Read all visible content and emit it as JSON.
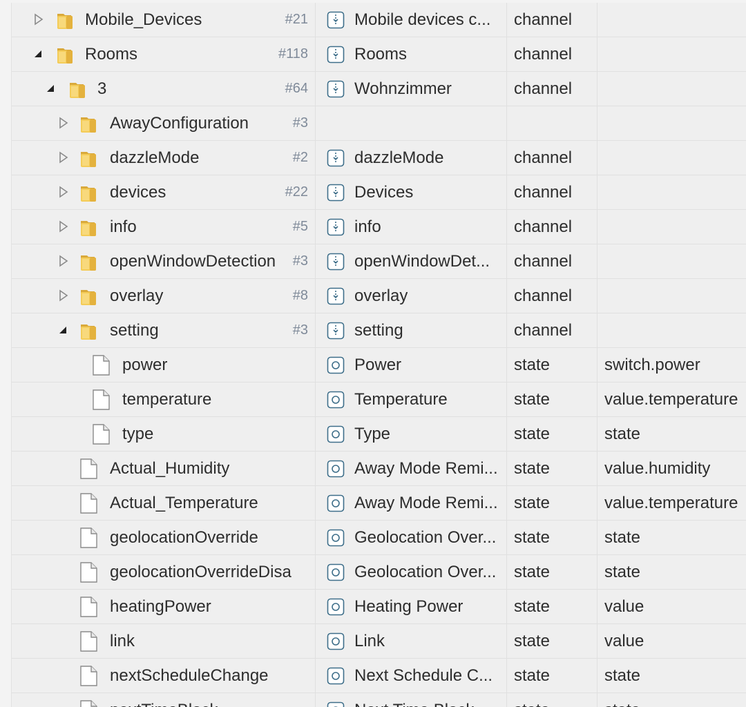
{
  "rows": [
    {
      "name": "Mobile_Devices",
      "count": "#21",
      "kind": "folder",
      "toggle": "collapsed",
      "level": 0,
      "title": "Mobile devices c...",
      "title_icon": "channel",
      "type": "channel",
      "role": ""
    },
    {
      "name": "Rooms",
      "count": "#118",
      "kind": "folder",
      "toggle": "expanded",
      "level": 0,
      "title": "Rooms",
      "title_icon": "channel",
      "type": "channel",
      "role": ""
    },
    {
      "name": "3",
      "count": "#64",
      "kind": "folder",
      "toggle": "expanded",
      "level": 1,
      "title": "Wohnzimmer",
      "title_icon": "channel",
      "type": "channel",
      "role": ""
    },
    {
      "name": "AwayConfiguration",
      "count": "#3",
      "kind": "folder",
      "toggle": "collapsed",
      "level": 2,
      "title": "",
      "title_icon": "",
      "type": "",
      "role": ""
    },
    {
      "name": "dazzleMode",
      "count": "#2",
      "kind": "folder",
      "toggle": "collapsed",
      "level": 2,
      "title": "dazzleMode",
      "title_icon": "channel",
      "type": "channel",
      "role": ""
    },
    {
      "name": "devices",
      "count": "#22",
      "kind": "folder",
      "toggle": "collapsed",
      "level": 2,
      "title": "Devices",
      "title_icon": "channel",
      "type": "channel",
      "role": ""
    },
    {
      "name": "info",
      "count": "#5",
      "kind": "folder",
      "toggle": "collapsed",
      "level": 2,
      "title": "info",
      "title_icon": "channel",
      "type": "channel",
      "role": ""
    },
    {
      "name": "openWindowDetection",
      "count": "#3",
      "kind": "folder",
      "toggle": "collapsed",
      "level": 2,
      "title": "openWindowDet...",
      "title_icon": "channel",
      "type": "channel",
      "role": ""
    },
    {
      "name": "overlay",
      "count": "#8",
      "kind": "folder",
      "toggle": "collapsed",
      "level": 2,
      "title": "overlay",
      "title_icon": "channel",
      "type": "channel",
      "role": ""
    },
    {
      "name": "setting",
      "count": "#3",
      "kind": "folder",
      "toggle": "expanded",
      "level": 2,
      "title": "setting",
      "title_icon": "channel",
      "type": "channel",
      "role": ""
    },
    {
      "name": "power",
      "count": "",
      "kind": "file",
      "toggle": "",
      "level": 3,
      "title": "Power",
      "title_icon": "state",
      "type": "state",
      "role": "switch.power"
    },
    {
      "name": "temperature",
      "count": "",
      "kind": "file",
      "toggle": "",
      "level": 3,
      "title": "Temperature",
      "title_icon": "state",
      "type": "state",
      "role": "value.temperature"
    },
    {
      "name": "type",
      "count": "",
      "kind": "file",
      "toggle": "",
      "level": 3,
      "title": "Type",
      "title_icon": "state",
      "type": "state",
      "role": "state"
    },
    {
      "name": "Actual_Humidity",
      "count": "",
      "kind": "file",
      "toggle": "",
      "level": 2,
      "title": "Away Mode Remi...",
      "title_icon": "state",
      "type": "state",
      "role": "value.humidity"
    },
    {
      "name": "Actual_Temperature",
      "count": "",
      "kind": "file",
      "toggle": "",
      "level": 2,
      "title": "Away Mode Remi...",
      "title_icon": "state",
      "type": "state",
      "role": "value.temperature"
    },
    {
      "name": "geolocationOverride",
      "count": "",
      "kind": "file",
      "toggle": "",
      "level": 2,
      "title": "Geolocation Over...",
      "title_icon": "state",
      "type": "state",
      "role": "state"
    },
    {
      "name": "geolocationOverrideDisa",
      "count": "",
      "kind": "file",
      "toggle": "",
      "level": 2,
      "title": "Geolocation Over...",
      "title_icon": "state",
      "type": "state",
      "role": "state"
    },
    {
      "name": "heatingPower",
      "count": "",
      "kind": "file",
      "toggle": "",
      "level": 2,
      "title": "Heating Power",
      "title_icon": "state",
      "type": "state",
      "role": "value"
    },
    {
      "name": "link",
      "count": "",
      "kind": "file",
      "toggle": "",
      "level": 2,
      "title": "Link",
      "title_icon": "state",
      "type": "state",
      "role": "value"
    },
    {
      "name": "nextScheduleChange",
      "count": "",
      "kind": "file",
      "toggle": "",
      "level": 2,
      "title": "Next Schedule C...",
      "title_icon": "state",
      "type": "state",
      "role": "state"
    },
    {
      "name": "nextTimeBlock",
      "count": "",
      "kind": "file",
      "toggle": "",
      "level": 2,
      "title": "Next Time Block",
      "title_icon": "state",
      "type": "state",
      "role": "state"
    }
  ],
  "icons": {
    "folder": "folder-icon",
    "file": "file-icon",
    "channel": "channel-icon",
    "state": "state-icon",
    "collapsed": "expand-arrow-icon",
    "expanded": "collapse-arrow-icon"
  },
  "colors": {
    "background": "#efefef",
    "text": "#2d2d2d",
    "count": "#7f8a99",
    "folder": "#e8c25a",
    "icon_stroke": "#3f6f8a"
  }
}
